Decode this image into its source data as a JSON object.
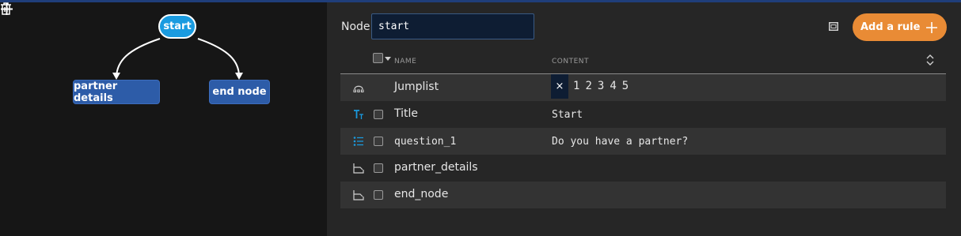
{
  "graph": {
    "start_node": "start",
    "children": [
      {
        "label": "partner details"
      },
      {
        "label": "end node"
      }
    ],
    "edge_color": "#ffffff",
    "start_color": "#1a9be0",
    "child_color": "#2d5ca8"
  },
  "editor": {
    "node_label": "Node",
    "node_value": "start",
    "add_rule_label": "Add a rule",
    "accent": "#e98b35"
  },
  "table": {
    "col_name": "NAME",
    "col_content": "CONTENT",
    "rows": [
      {
        "icon": "jumplist-icon",
        "name": "Jumplist",
        "content": ""
      },
      {
        "icon": "title-icon",
        "name": "Title",
        "content": "Start"
      },
      {
        "icon": "list-icon",
        "name": "question_1",
        "content": "Do you have a partner?"
      },
      {
        "icon": "branch-icon",
        "name": "partner_details",
        "content": ""
      },
      {
        "icon": "branch-icon",
        "name": "end_node",
        "content": ""
      }
    ],
    "jumplist": {
      "close": "×",
      "pages": [
        "1",
        "2",
        "3",
        "4",
        "5"
      ]
    }
  }
}
